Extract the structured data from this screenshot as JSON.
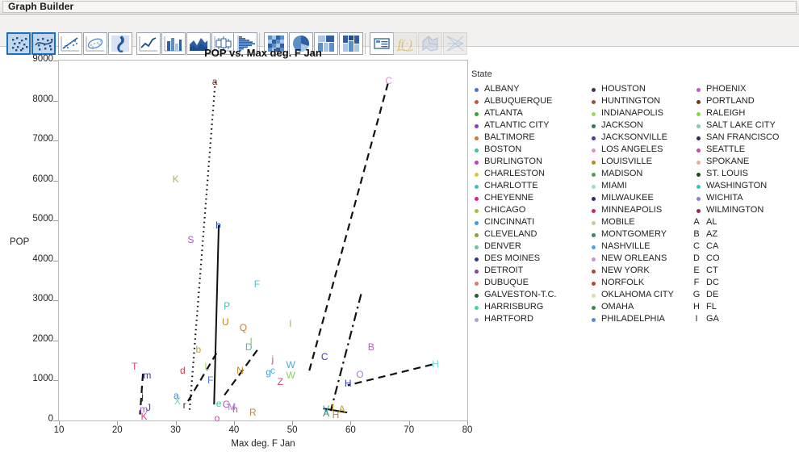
{
  "window": {
    "title": "Graph Builder"
  },
  "toolbar": {
    "buttons": [
      {
        "name": "points-plot-button",
        "label": "Points",
        "selected": true,
        "dim": false
      },
      {
        "name": "smoother-plot-button",
        "label": "Smoother",
        "selected": true,
        "dim": false
      },
      {
        "name": "line-of-fit-button",
        "label": "Line of Fit",
        "selected": false,
        "dim": false
      },
      {
        "name": "ellipse-button",
        "label": "Ellipse",
        "selected": false,
        "dim": false
      },
      {
        "name": "contour-button",
        "label": "Contour",
        "selected": false,
        "dim": false
      },
      {
        "name": "line-chart-button",
        "label": "Line",
        "selected": false,
        "dim": false
      },
      {
        "name": "bar-chart-button",
        "label": "Bar",
        "selected": false,
        "dim": false
      },
      {
        "name": "area-chart-button",
        "label": "Area",
        "selected": false,
        "dim": false
      },
      {
        "name": "box-plot-button",
        "label": "Box Plot",
        "selected": false,
        "dim": false
      },
      {
        "name": "histogram-button",
        "label": "Histogram",
        "selected": false,
        "dim": false
      },
      {
        "name": "heatmap-button",
        "label": "Heatmap",
        "selected": false,
        "dim": false
      },
      {
        "name": "pie-chart-button",
        "label": "Pie",
        "selected": false,
        "dim": false
      },
      {
        "name": "treemap-button",
        "label": "Treemap",
        "selected": false,
        "dim": false
      },
      {
        "name": "mosaic-button",
        "label": "Mosaic",
        "selected": false,
        "dim": false
      },
      {
        "name": "caption-box-button",
        "label": "Caption Box",
        "selected": false,
        "dim": false
      },
      {
        "name": "formula-button",
        "label": "Formula",
        "selected": false,
        "dim": true
      },
      {
        "name": "map-shapes-button",
        "label": "Map Shapes",
        "selected": false,
        "dim": true
      },
      {
        "name": "parallel-plot-button",
        "label": "Parallel Plot",
        "selected": false,
        "dim": true
      }
    ]
  },
  "chart_data": {
    "type": "scatter",
    "title": "POP vs. Max deg. F Jan",
    "xlabel": "Max deg. F Jan",
    "ylabel": "POP",
    "xlim": [
      10,
      80
    ],
    "ylim": [
      0,
      9000
    ],
    "xticks": [
      10,
      20,
      30,
      40,
      50,
      60,
      70,
      80
    ],
    "yticks": [
      0,
      1000,
      2000,
      3000,
      4000,
      5000,
      6000,
      7000,
      8000,
      9000
    ],
    "grid": false,
    "legend_position": "right",
    "legend_title": "State",
    "points": [
      {
        "label": "a",
        "x": 36.8,
        "y": 8470,
        "color": "#7b2d26"
      },
      {
        "label": "C",
        "x": 66.5,
        "y": 8490,
        "color": "#e58fd0"
      },
      {
        "label": "K",
        "x": 30.0,
        "y": 6030,
        "color": "#9fc23f"
      },
      {
        "label": "S",
        "x": 32.6,
        "y": 4520,
        "color": "#9b59c6"
      },
      {
        "label": "b",
        "x": 37.4,
        "y": 4890,
        "color": "#2b4fa2"
      },
      {
        "label": "F",
        "x": 44.0,
        "y": 3410,
        "color": "#45c6c6"
      },
      {
        "label": "P",
        "x": 38.8,
        "y": 2870,
        "color": "#3fc0b6"
      },
      {
        "label": "U",
        "x": 38.5,
        "y": 2460,
        "color": "#b88a1e"
      },
      {
        "label": "Q",
        "x": 41.5,
        "y": 2320,
        "color": "#d07a28"
      },
      {
        "label": "I",
        "x": 50.0,
        "y": 2420,
        "color": "#8cc63f"
      },
      {
        "label": "D",
        "x": 42.5,
        "y": 1830,
        "color": "#3fc0b6"
      },
      {
        "label": "l",
        "x": 43.3,
        "y": 1970,
        "color": "#7fc04d"
      },
      {
        "label": "T",
        "x": 23.0,
        "y": 1350,
        "color": "#e0407c"
      },
      {
        "label": "b",
        "x": 34.0,
        "y": 1770,
        "color": "#b8a23a"
      },
      {
        "label": "L",
        "x": 35.5,
        "y": 1360,
        "color": "#9fd46a"
      },
      {
        "label": "j",
        "x": 47.0,
        "y": 1540,
        "color": "#b04fa8"
      },
      {
        "label": "W",
        "x": 49.5,
        "y": 1400,
        "color": "#4ea7e0"
      },
      {
        "label": "N",
        "x": 41.0,
        "y": 1260,
        "color": "#c08a2a"
      },
      {
        "label": "g",
        "x": 46.0,
        "y": 1220,
        "color": "#4da0d8"
      },
      {
        "label": "c",
        "x": 46.8,
        "y": 1250,
        "color": "#44c0d8"
      },
      {
        "label": "W",
        "x": 49.5,
        "y": 1120,
        "color": "#8cd05a"
      },
      {
        "label": "Z",
        "x": 48.0,
        "y": 960,
        "color": "#e0407c"
      },
      {
        "label": "m",
        "x": 25.0,
        "y": 1140,
        "color": "#3d2f8f"
      },
      {
        "label": "d",
        "x": 31.3,
        "y": 1260,
        "color": "#d6384f"
      },
      {
        "label": "F",
        "x": 36.0,
        "y": 1010,
        "color": "#4a7fd8"
      },
      {
        "label": "B",
        "x": 63.5,
        "y": 1830,
        "color": "#c04fd0"
      },
      {
        "label": "C",
        "x": 55.5,
        "y": 1600,
        "color": "#3c3ca8"
      },
      {
        "label": "O",
        "x": 61.5,
        "y": 1150,
        "color": "#b07fd8"
      },
      {
        "label": "H",
        "x": 74.5,
        "y": 1410,
        "color": "#6fd8d8"
      },
      {
        "label": "H",
        "x": 59.5,
        "y": 920,
        "color": "#3c3cc8"
      },
      {
        "label": "a",
        "x": 30.2,
        "y": 620,
        "color": "#4a7fd8"
      },
      {
        "label": "X",
        "x": 30.3,
        "y": 490,
        "color": "#69d6c6"
      },
      {
        "label": "e",
        "x": 37.5,
        "y": 430,
        "color": "#2fc8a8"
      },
      {
        "label": "G",
        "x": 38.6,
        "y": 400,
        "color": "#b04fd0"
      },
      {
        "label": "M",
        "x": 39.5,
        "y": 340,
        "color": "#9f7fd8"
      },
      {
        "label": "h",
        "x": 40.3,
        "y": 280,
        "color": "#c04fa0"
      },
      {
        "label": "R",
        "x": 43.2,
        "y": 200,
        "color": "#b08a4a"
      },
      {
        "label": "r",
        "x": 31.8,
        "y": 390,
        "color": "#2f2f2f"
      },
      {
        "label": "m",
        "x": 24.4,
        "y": 290,
        "color": "#9b59c6"
      },
      {
        "label": "J",
        "x": 25.5,
        "y": 320,
        "color": "#3c3cc8"
      },
      {
        "label": "j",
        "x": 24.7,
        "y": 600,
        "color": "#2f2f2f"
      },
      {
        "label": "K",
        "x": 24.6,
        "y": 110,
        "color": "#e0407c"
      },
      {
        "label": "o",
        "x": 37.2,
        "y": 60,
        "color": "#c04fa8"
      },
      {
        "label": "V",
        "x": 55.8,
        "y": 290,
        "color": "#3fa0c0"
      },
      {
        "label": "f",
        "x": 57.3,
        "y": 330,
        "color": "#c8a83a"
      },
      {
        "label": "A",
        "x": 58.5,
        "y": 290,
        "color": "#b8a23a"
      },
      {
        "label": "A",
        "x": 55.8,
        "y": 190,
        "color": "#2f8f6f"
      },
      {
        "label": "H",
        "x": 57.4,
        "y": 150,
        "color": "#b08a4a"
      }
    ],
    "trend_lines": [
      {
        "name": "dotted-steep-line",
        "style": "dotted",
        "x1": 36.8,
        "y1": 8470,
        "x2": 32.4,
        "y2": 250
      },
      {
        "name": "solid-vertical-line",
        "style": "solid",
        "x1": 37.4,
        "y1": 4890,
        "x2": 36.6,
        "y2": 400
      },
      {
        "name": "dashed-rising-line",
        "style": "dashed",
        "x1": 66.4,
        "y1": 8430,
        "x2": 52.7,
        "y2": 1130
      },
      {
        "name": "dash-dot-line",
        "style": "dashdot",
        "x1": 61.8,
        "y1": 3160,
        "x2": 56.6,
        "y2": 240
      },
      {
        "name": "dashed-short-left-line",
        "style": "dashed",
        "x1": 24.4,
        "y1": 1170,
        "x2": 23.9,
        "y2": 150
      },
      {
        "name": "dashed-low-right-line",
        "style": "dashed",
        "x1": 74.0,
        "y1": 1400,
        "x2": 59.5,
        "y2": 880
      },
      {
        "name": "dashed-mid-line",
        "style": "dashed",
        "x1": 44.0,
        "y1": 1760,
        "x2": 38.2,
        "y2": 600
      },
      {
        "name": "dashed-mid-line-2",
        "style": "dashed",
        "x1": 37.0,
        "y1": 1680,
        "x2": 31.8,
        "y2": 400
      },
      {
        "name": "solid-bottom-right-line",
        "style": "solid",
        "x1": 59.4,
        "y1": 200,
        "x2": 55.3,
        "y2": 300
      }
    ]
  },
  "legend": {
    "title": "State",
    "columns": [
      {
        "name": "legend-column-1",
        "entries": [
          {
            "label": "ALBANY",
            "color": "#4a6fd8",
            "marker": "dot"
          },
          {
            "label": "ALBUQUERQUE",
            "color": "#c0564a",
            "marker": "dot"
          },
          {
            "label": "ATLANTA",
            "color": "#3ba03b",
            "marker": "dot"
          },
          {
            "label": "ATLANTIC CITY",
            "color": "#8b3fc0",
            "marker": "dot"
          },
          {
            "label": "BALTIMORE",
            "color": "#d07a28",
            "marker": "dot"
          },
          {
            "label": "BOSTON",
            "color": "#3fc0a8",
            "marker": "dot"
          },
          {
            "label": "BURLINGTON",
            "color": "#c040b8",
            "marker": "dot"
          },
          {
            "label": "CHARLESTON",
            "color": "#d8c83a",
            "marker": "dot"
          },
          {
            "label": "CHARLOTTE",
            "color": "#3fc0c0",
            "marker": "dot"
          },
          {
            "label": "CHEYENNE",
            "color": "#e01f8f",
            "marker": "dot"
          },
          {
            "label": "CHICAGO",
            "color": "#9fc23f",
            "marker": "dot"
          },
          {
            "label": "CINCINNATI",
            "color": "#3fa0d8",
            "marker": "dot"
          },
          {
            "label": "CLEVELAND",
            "color": "#8f9f2f",
            "marker": "dot"
          },
          {
            "label": "DENVER",
            "color": "#6fc0a8",
            "marker": "dot"
          },
          {
            "label": "DES MOINES",
            "color": "#2a3a7a",
            "marker": "dot"
          },
          {
            "label": "DETROIT",
            "color": "#7a4f9f",
            "marker": "dot"
          },
          {
            "label": "DUBUQUE",
            "color": "#e07a6a",
            "marker": "dot"
          },
          {
            "label": "GALVESTON-T.C.",
            "color": "#2f5f2f",
            "marker": "dot"
          },
          {
            "label": "HARRISBURG",
            "color": "#3fd8a8",
            "marker": "dot"
          },
          {
            "label": "HARTFORD",
            "color": "#9fa8d0",
            "marker": "dot"
          }
        ]
      },
      {
        "name": "legend-column-2",
        "entries": [
          {
            "label": "HOUSTON",
            "color": "#4a2a6a",
            "marker": "dot"
          },
          {
            "label": "HUNTINGTON",
            "color": "#8a5a2a",
            "marker": "dot"
          },
          {
            "label": "INDIANAPOLIS",
            "color": "#8fe04a",
            "marker": "dot"
          },
          {
            "label": "JACKSON",
            "color": "#2f7a5f",
            "marker": "dot"
          },
          {
            "label": "JACKSONVILLE",
            "color": "#3a3ac0",
            "marker": "dot"
          },
          {
            "label": "LOS ANGELES",
            "color": "#e08fd0",
            "marker": "dot"
          },
          {
            "label": "LOUISVILLE",
            "color": "#c08a1a",
            "marker": "dot"
          },
          {
            "label": "MADISON",
            "color": "#4aa05a",
            "marker": "dot"
          },
          {
            "label": "MIAMI",
            "color": "#8fe0e0",
            "marker": "dot"
          },
          {
            "label": "MILWAUKEE",
            "color": "#2a2a7a",
            "marker": "dot"
          },
          {
            "label": "MINNEAPOLIS",
            "color": "#e01f5f",
            "marker": "dot"
          },
          {
            "label": "MOBILE",
            "color": "#d0c89a",
            "marker": "dot"
          },
          {
            "label": "MONTGOMERY",
            "color": "#2f8f4f",
            "marker": "dot"
          },
          {
            "label": "NASHVILLE",
            "color": "#4aa8e0",
            "marker": "dot"
          },
          {
            "label": "NEW ORLEANS",
            "color": "#d08fe0",
            "marker": "dot"
          },
          {
            "label": "NEW YORK",
            "color": "#a0503a",
            "marker": "dot"
          },
          {
            "label": "NORFOLK",
            "color": "#d03a3a",
            "marker": "dot"
          },
          {
            "label": "OKLAHOMA CITY",
            "color": "#d8e0a0",
            "marker": "dot"
          },
          {
            "label": "OMAHA",
            "color": "#2f8f4f",
            "marker": "dot"
          },
          {
            "label": "PHILADELPHIA",
            "color": "#4a8fd8",
            "marker": "dot"
          }
        ]
      },
      {
        "name": "legend-column-3",
        "entries": [
          {
            "label": "PHOENIX",
            "color": "#d04fd0",
            "marker": "dot"
          },
          {
            "label": "PORTLAND",
            "color": "#6a3a1a",
            "marker": "dot"
          },
          {
            "label": "RALEIGH",
            "color": "#7fe02f",
            "marker": "dot"
          },
          {
            "label": "SALT LAKE CITY",
            "color": "#8fc8b0",
            "marker": "dot"
          },
          {
            "label": "SAN FRANCISCO",
            "color": "#2a2a6a",
            "marker": "dot"
          },
          {
            "label": "SEATTLE",
            "color": "#c04fa8",
            "marker": "dot"
          },
          {
            "label": "SPOKANE",
            "color": "#e8b08a",
            "marker": "dot"
          },
          {
            "label": "ST. LOUIS",
            "color": "#1f4a1f",
            "marker": "dot"
          },
          {
            "label": "WASHINGTON",
            "color": "#2fc8c8",
            "marker": "dot"
          },
          {
            "label": "WICHITA",
            "color": "#8f7fd0",
            "marker": "dot"
          },
          {
            "label": "WILMINGTON",
            "color": "#a01f5f",
            "marker": "dot"
          },
          {
            "label": "AL",
            "color": "#222222",
            "marker": "A"
          },
          {
            "label": "AZ",
            "color": "#222222",
            "marker": "B"
          },
          {
            "label": "CA",
            "color": "#222222",
            "marker": "C"
          },
          {
            "label": "CO",
            "color": "#222222",
            "marker": "D"
          },
          {
            "label": "CT",
            "color": "#222222",
            "marker": "E"
          },
          {
            "label": "DC",
            "color": "#222222",
            "marker": "F"
          },
          {
            "label": "DE",
            "color": "#222222",
            "marker": "G"
          },
          {
            "label": "FL",
            "color": "#222222",
            "marker": "H"
          },
          {
            "label": "GA",
            "color": "#222222",
            "marker": "I"
          }
        ]
      }
    ]
  }
}
